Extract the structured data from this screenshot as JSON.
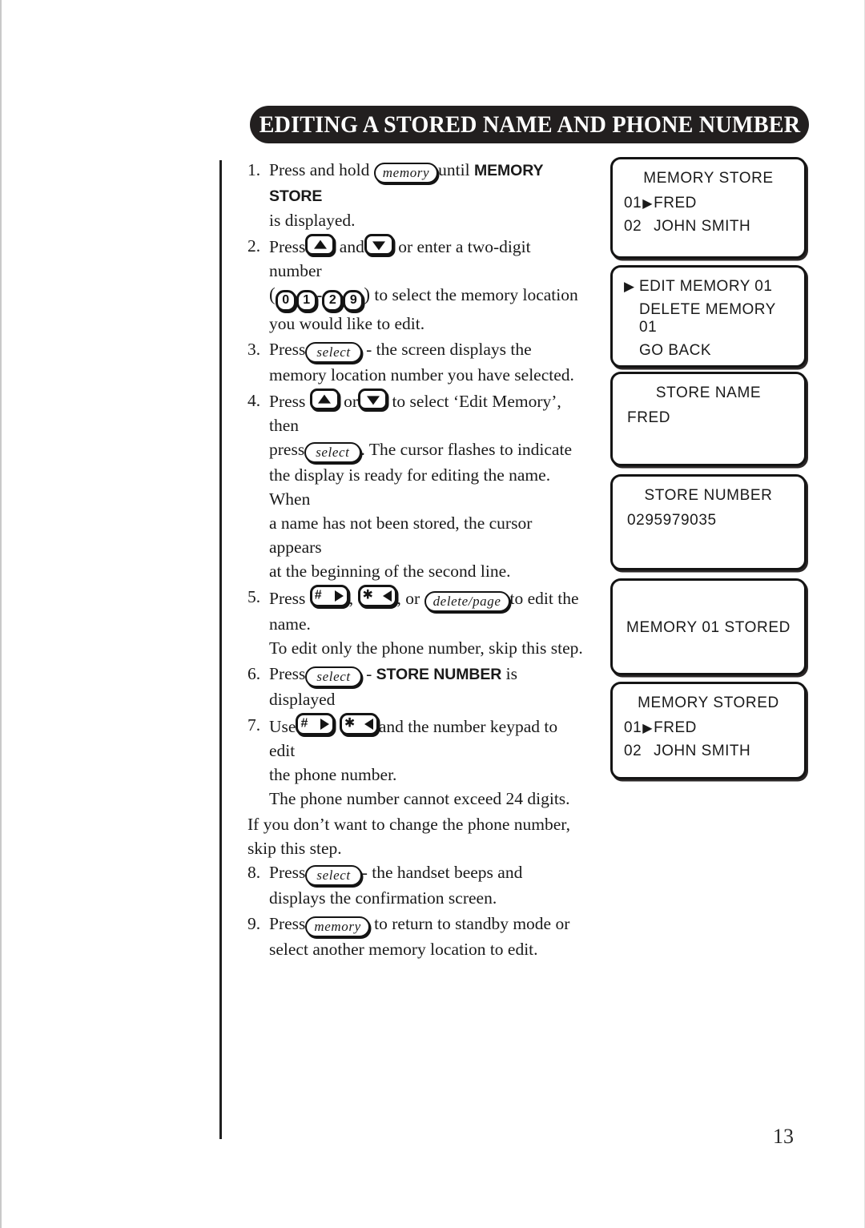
{
  "header": {
    "title": "EDITING A STORED NAME AND PHONE NUMBER"
  },
  "page_number": "13",
  "keys": {
    "memory": "memory",
    "select": "select",
    "delete_page": "delete/page",
    "hash": "#",
    "star": "✱",
    "digit_0": "0",
    "digit_1": "1",
    "digit_2": "2",
    "digit_9": "9",
    "up_arrow_icon": "up-arrow-key",
    "down_arrow_icon": "down-arrow-key",
    "right_arrow_icon": "right-arrow-key",
    "left_arrow_icon": "left-arrow-key"
  },
  "steps": [
    {
      "number": "1.",
      "t1": "Press and hold",
      "t2": "until",
      "bold": "MEMORY STORE",
      "t3": "is displayed."
    },
    {
      "number": "2.",
      "t1": "Press",
      "t2": "and",
      "t3": "or enter a two-digit number",
      "t4": "to select the memory location",
      "t5": "you would like to edit."
    },
    {
      "number": "3.",
      "t1": "Press",
      "t2": "- the screen displays the",
      "t3": "memory location number you have selected."
    },
    {
      "number": "4.",
      "t1": "Press",
      "t2": "or",
      "t3": "to select ‘Edit Memory’, then",
      "t4": "press",
      "t5": ".  The cursor flashes to indicate",
      "t6": "the display is ready for editing the name. When",
      "t7": "a name has not been stored, the cursor appears",
      "t8": "at the beginning of the second line."
    },
    {
      "number": "5.",
      "t1": "Press",
      "t2": ",",
      "t3": ", or",
      "t4": "to edit the",
      "t5": "name.",
      "t6": "To edit only the phone number, skip this step."
    },
    {
      "number": "6.",
      "t1": "Press",
      "t2": "-",
      "bold": "STORE NUMBER",
      "t3": "is",
      "t4": "displayed"
    },
    {
      "number": "7.",
      "t1": "Use",
      "t2": "and the number keypad to edit",
      "t3": "the phone number.",
      "t4": "The phone number cannot exceed 24 digits."
    },
    {
      "number": "8.",
      "t1": "Press",
      "t2": "- the handset beeps and",
      "t3": "displays the confirmation screen."
    },
    {
      "number": "9.",
      "t1": "Press",
      "t2": "to return to standby mode or",
      "t3": "select another memory location to edit."
    }
  ],
  "note_paragraph": {
    "line1": "If you don’t want to change the phone number,",
    "line2": "skip this step."
  },
  "lcd_screens": [
    {
      "id": "memory-store",
      "title": "MEMORY STORE",
      "rows": [
        {
          "index": "01",
          "cursor": "▶",
          "label": "FRED"
        },
        {
          "index": "02",
          "cursor": "",
          "label": "JOHN SMITH"
        }
      ]
    },
    {
      "id": "edit-memory-menu",
      "items": [
        {
          "marker": "▶",
          "label": "EDIT MEMORY 01"
        },
        {
          "marker": "",
          "label": "DELETE MEMORY 01"
        },
        {
          "marker": "",
          "label": "GO BACK"
        }
      ]
    },
    {
      "id": "store-name",
      "title": "STORE NAME",
      "value": "FRED"
    },
    {
      "id": "store-number",
      "title": "STORE NUMBER",
      "value": "0295979035"
    },
    {
      "id": "memory-01-stored",
      "message": "MEMORY 01 STORED"
    },
    {
      "id": "memory-stored",
      "title": "MEMORY STORED",
      "rows": [
        {
          "index": "01",
          "cursor": "▶",
          "label": "FRED"
        },
        {
          "index": "02",
          "cursor": "",
          "label": "JOHN SMITH"
        }
      ]
    }
  ]
}
